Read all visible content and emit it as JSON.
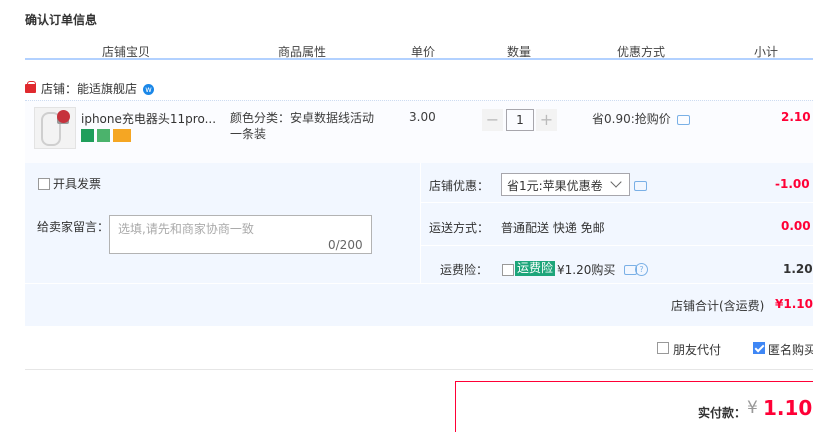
{
  "title": "确认订单信息",
  "columns": [
    "店铺宝贝",
    "商品属性",
    "单价",
    "数量",
    "优惠方式",
    "小计"
  ],
  "shop": {
    "label": "店铺：能适旗舰店"
  },
  "item": {
    "title": "iphone充电器头11pro...",
    "attr_line1": "颜色分类：安卓数据线活动",
    "attr_line2": "一条装",
    "price": "3.00",
    "qty_minus": "−",
    "quantity": "1",
    "qty_plus": "+",
    "promo": "省0.90:抢购价",
    "subtotal": "2.10"
  },
  "invoice_label": "开具发票",
  "message": {
    "label": "给卖家留言：",
    "placeholder": "选填,请先和商家协商一致",
    "count": "0/200"
  },
  "shop_discount": {
    "label": "店铺优惠：",
    "selected": "省1元:苹果优惠卷",
    "value": "-1.00"
  },
  "shipping": {
    "label": "运送方式：",
    "value_text": "普通配送 快递 免邮",
    "value": "0.00"
  },
  "insurance": {
    "label": "运费险：",
    "badge": "运费险",
    "text": "¥1.20购买",
    "value": "1.20"
  },
  "shop_total": {
    "label": "店铺合计(含运费)",
    "value": "¥1.10"
  },
  "friend_pay": "朋友代付",
  "anonymous": "匿名购买",
  "pay": {
    "label": "实付款：",
    "currency": "¥",
    "amount": "1.10"
  },
  "colors": {
    "accent_red": "#ff0036",
    "header_line": "#b2d1ff",
    "panel_bg": "#f2f7ff",
    "check_blue": "#3f87f5"
  }
}
